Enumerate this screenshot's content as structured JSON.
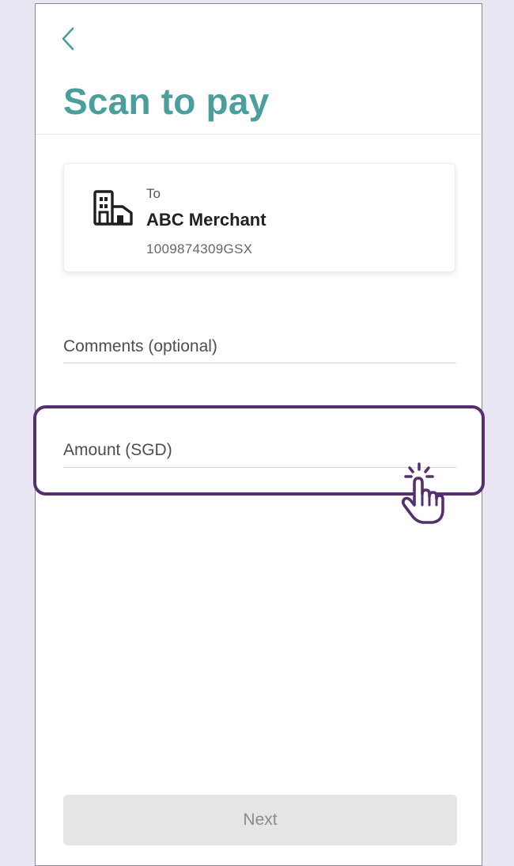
{
  "header": {
    "title": "Scan to pay",
    "back_icon": "chevron-left-icon"
  },
  "merchant_card": {
    "to_label": "To",
    "merchant_name": "ABC Merchant",
    "merchant_id": "1009874309GSX",
    "icon": "building-icon"
  },
  "form": {
    "comments_placeholder": "Comments (optional)",
    "amount_placeholder": "Amount (SGD)"
  },
  "footer": {
    "next_label": "Next"
  },
  "overlay": {
    "highlight_color": "#54306e",
    "tap_icon": "tap-hand-icon"
  },
  "colors": {
    "title": "#4a9f9c",
    "background": "#ebe6f3",
    "next_disabled": "#e5e5e5"
  }
}
